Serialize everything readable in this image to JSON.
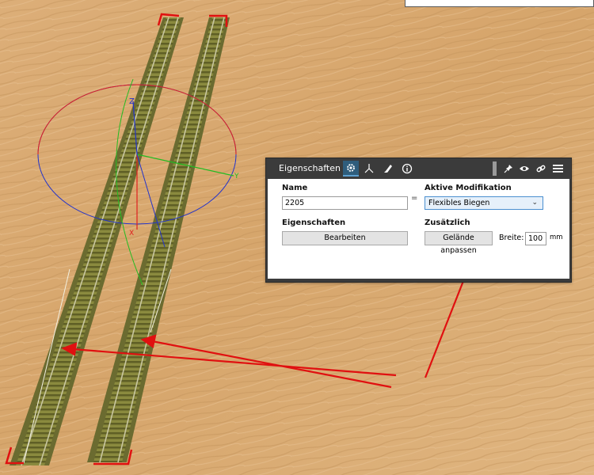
{
  "panel": {
    "tab_title": "Eigenschaften",
    "header_icons": [
      "gear-icon",
      "axis-icon",
      "brush-icon",
      "info-icon",
      "pin-icon",
      "eye-icon",
      "link-icon",
      "menu-icon"
    ],
    "name_label": "Name",
    "name_value": "2205",
    "name_marker": "=",
    "active_mod_label": "Aktive Modifikation",
    "active_mod_value": "Flexibles Biegen",
    "props_label": "Eigenschaften",
    "edit_button": "Bearbeiten",
    "extra_label": "Zusätzlich",
    "terrain_button": "Gelände anpassen",
    "width_label": "Breite:",
    "width_value": "100",
    "width_unit": "mm"
  },
  "gizmo": {
    "z_label": "Z",
    "y_label": "Y",
    "x_label": "X"
  },
  "colors": {
    "accent": "#2f5d7c",
    "annotation": "#e01010",
    "gizmo_x": "#e02020",
    "gizmo_y": "#22bb22",
    "gizmo_z": "#2233cc",
    "floor": "#d9aa72"
  }
}
